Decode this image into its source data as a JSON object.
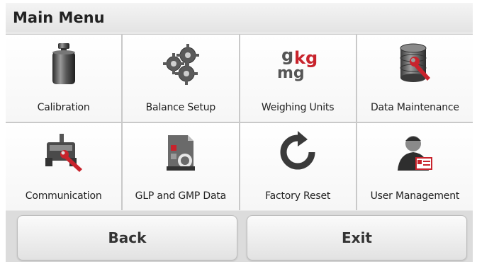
{
  "window": {
    "title": "Main Menu"
  },
  "menu": {
    "items": [
      {
        "label": "Calibration",
        "icon": "calibration-weight-icon"
      },
      {
        "label": "Balance Setup",
        "icon": "gears-icon"
      },
      {
        "label": "Weighing Units",
        "icon": "units-g-kg-mg-icon",
        "icon_text": {
          "g": "g",
          "kg": "kg",
          "mg": "mg"
        }
      },
      {
        "label": "Data Maintenance",
        "icon": "database-wrench-icon"
      },
      {
        "label": "Communication",
        "icon": "printer-wrench-icon"
      },
      {
        "label": "GLP and GMP Data",
        "icon": "document-glp-icon"
      },
      {
        "label": "Factory Reset",
        "icon": "reset-arrow-icon"
      },
      {
        "label": "User Management",
        "icon": "user-badge-icon"
      }
    ]
  },
  "buttons": {
    "back": "Back",
    "exit": "Exit"
  },
  "colors": {
    "accent_red": "#c8232c",
    "background": "#e9e9e9",
    "tile": "#f8f8f8"
  }
}
